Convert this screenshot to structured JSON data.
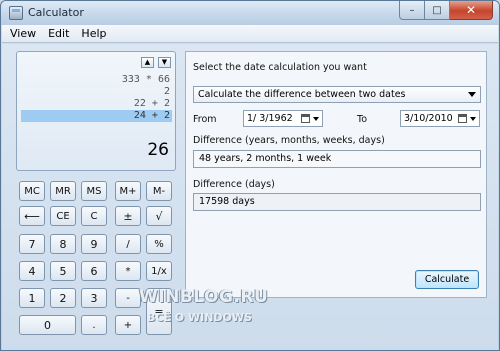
{
  "window": {
    "title": "Calculator",
    "controls": {
      "minimize": "–",
      "maximize": "□",
      "close": "✕"
    }
  },
  "menu": {
    "view": "View",
    "edit": "Edit",
    "help": "Help"
  },
  "display": {
    "history": [
      "333 * 66",
      "2",
      "22 + 2",
      "24 + 2"
    ],
    "selected_history_index": 3,
    "result": "26",
    "history_up": "▲",
    "history_down": "▼"
  },
  "keys": {
    "mc": "MC",
    "mr": "MR",
    "ms": "MS",
    "mplus": "M+",
    "mminus": "M-",
    "backspace": "⟵",
    "ce": "CE",
    "c": "C",
    "plusminus": "±",
    "sqrt": "√",
    "k7": "7",
    "k8": "8",
    "k9": "9",
    "divide": "/",
    "percent": "%",
    "k4": "4",
    "k5": "5",
    "k6": "6",
    "multiply": "*",
    "reciprocal": "1/x",
    "k1": "1",
    "k2": "2",
    "k3": "3",
    "minus": "-",
    "equals": "=",
    "k0": "0",
    "decimal": ".",
    "plus": "+"
  },
  "date_panel": {
    "prompt": "Select the date calculation you want",
    "mode": "Calculate the difference between two dates",
    "from_label": "From",
    "from_value": "1/ 3/1962",
    "to_label": "To",
    "to_value": "3/10/2010",
    "diff_label": "Difference (years, months, weeks, days)",
    "diff_value": "48 years, 2 months, 1 week",
    "days_label": "Difference (days)",
    "days_value": "17598 days",
    "calculate_label": "Calculate"
  },
  "watermark": {
    "line1": "WINBLOG.RU",
    "line2": "ВСЁ О WINDOWS"
  }
}
